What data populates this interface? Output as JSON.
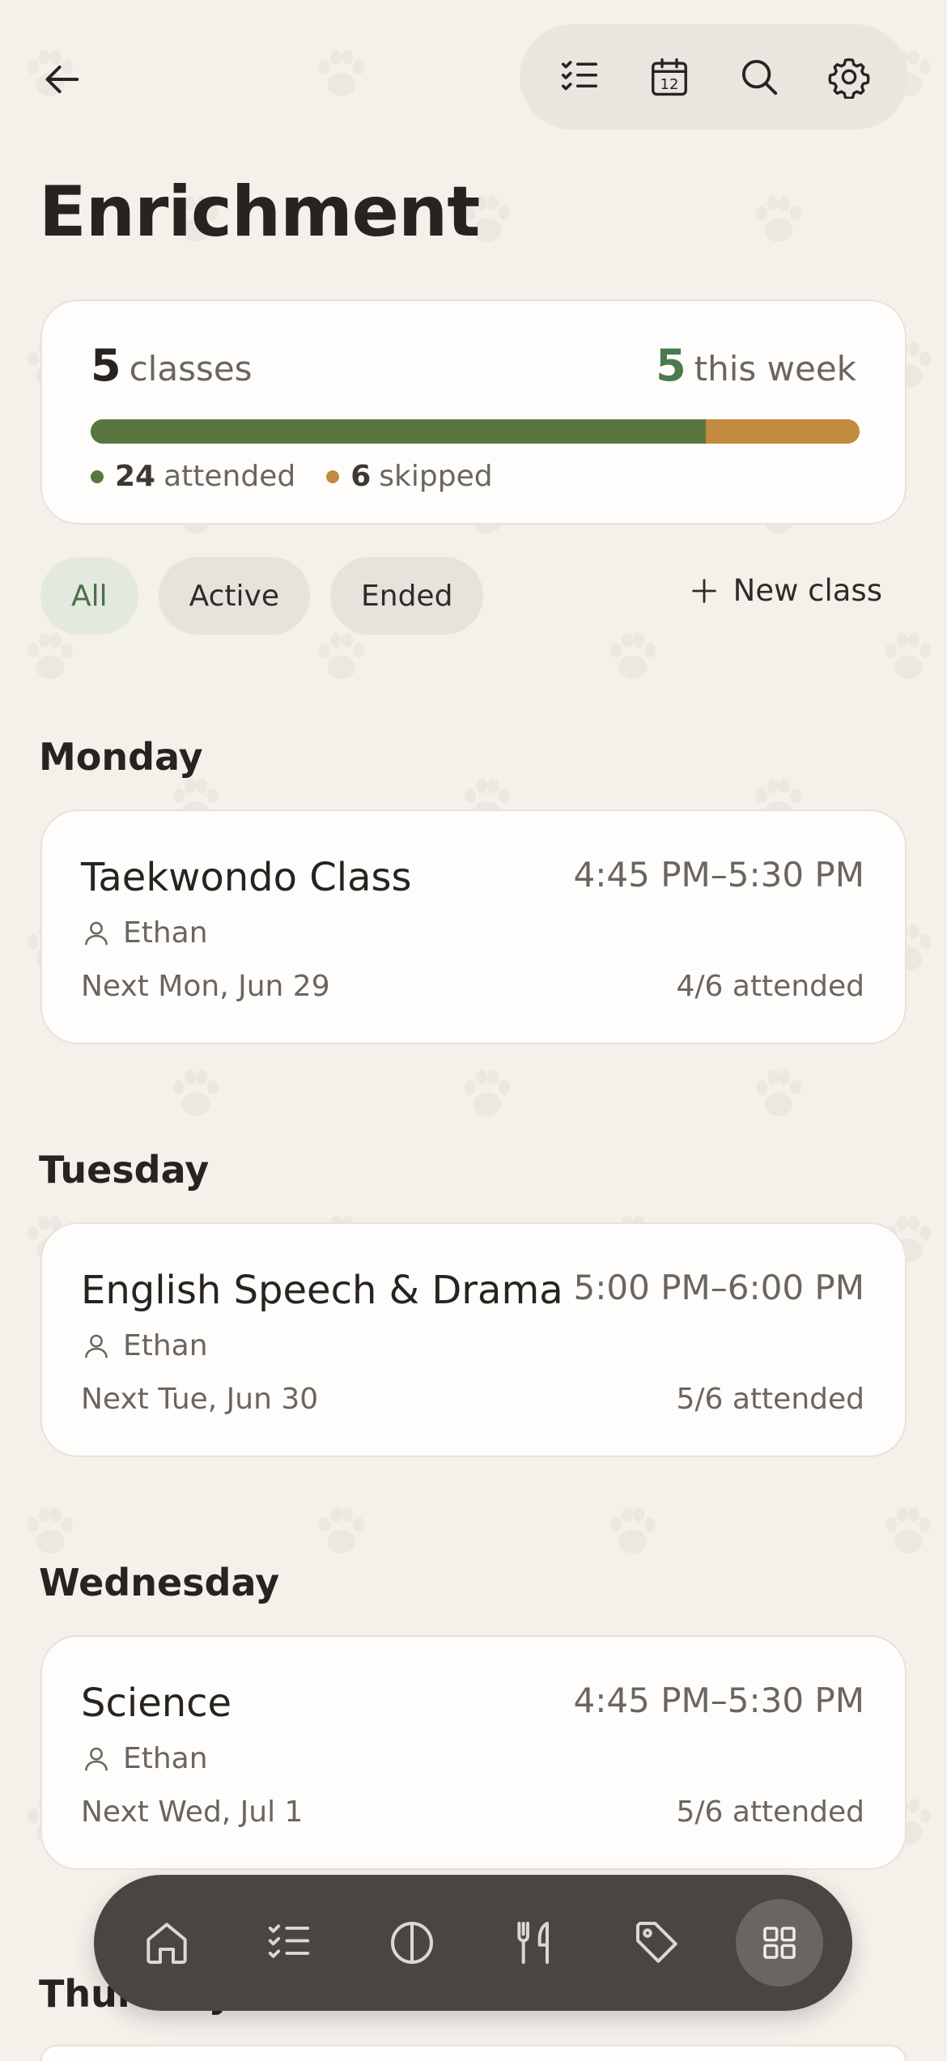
{
  "header": {
    "title": "Enrichment",
    "toolbar": [
      "checklist-icon",
      "calendar-icon",
      "search-icon",
      "gear-icon"
    ],
    "calendar_day": "12"
  },
  "summary": {
    "classes_count": "5",
    "classes_label": "classes",
    "week_count": "5",
    "week_label": "this week",
    "attended_count": "24",
    "attended_label": "attended",
    "skipped_count": "6",
    "skipped_label": "skipped",
    "attended_fraction": 0.8,
    "colors": {
      "attended": "#5a7640",
      "skipped": "#c28a3e",
      "week": "#4a7a4e"
    }
  },
  "filters": {
    "chips": [
      "All",
      "Active",
      "Ended"
    ],
    "selected": "All",
    "new_class_label": "New class"
  },
  "days": [
    {
      "day": "Monday",
      "class": {
        "name": "Taekwondo Class",
        "time": "4:45 PM–5:30 PM",
        "person": "Ethan",
        "next": "Next Mon, Jun 29",
        "attended": "4/6 attended"
      }
    },
    {
      "day": "Tuesday",
      "class": {
        "name": "English Speech & Drama",
        "time": "5:00 PM–6:00 PM",
        "person": "Ethan",
        "next": "Next Tue, Jun 30",
        "attended": "5/6 attended"
      }
    },
    {
      "day": "Wednesday",
      "class": {
        "name": "Science",
        "time": "4:45 PM–5:30 PM",
        "person": "Ethan",
        "next": "Next Wed, Jul 1",
        "attended": "5/6 attended"
      }
    },
    {
      "day": "Thursday"
    }
  ],
  "bottom_nav": {
    "items": [
      "home-icon",
      "checklist-icon",
      "half-circle-icon",
      "fork-knife-icon",
      "tag-icon",
      "grid-icon"
    ],
    "active": "grid-icon"
  }
}
